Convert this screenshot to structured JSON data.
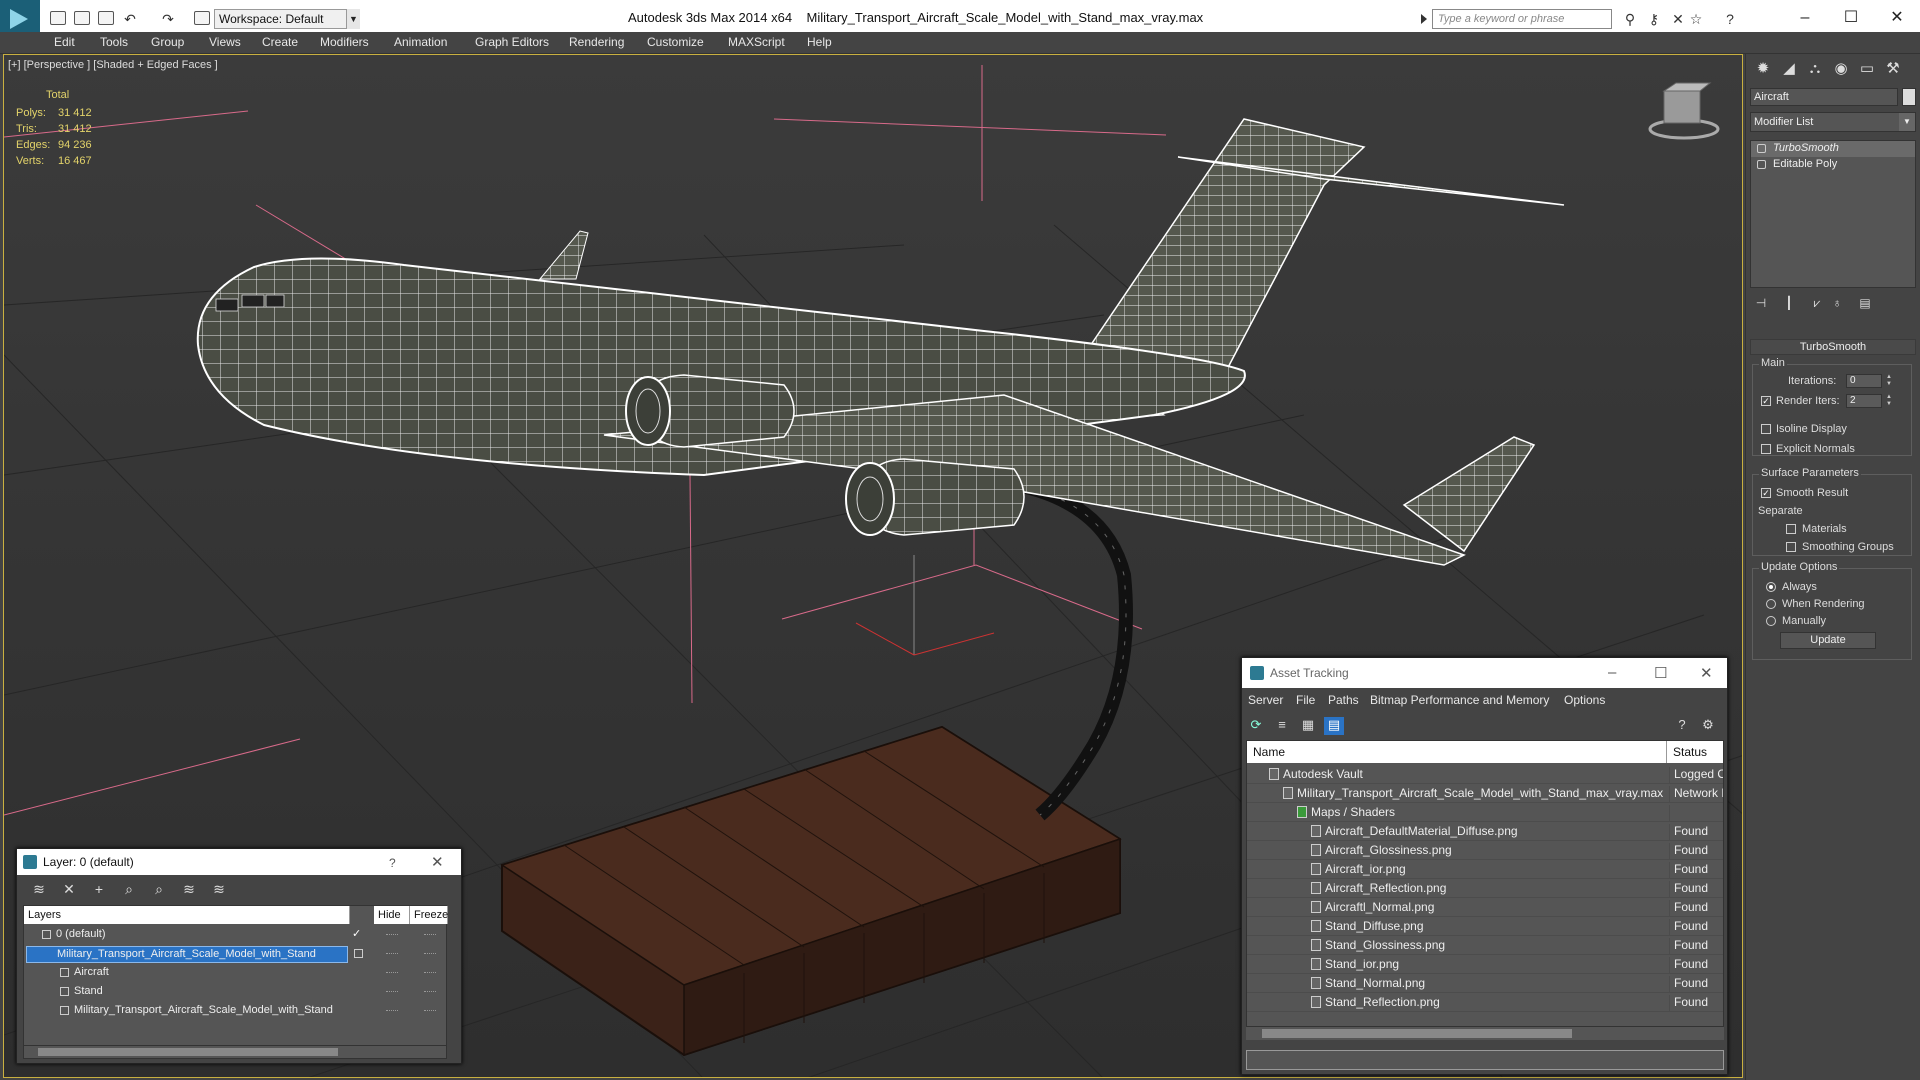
{
  "titlebar": {
    "workspace": "Workspace: Default",
    "app_name": "Autodesk 3ds Max  2014 x64",
    "file_name": "Military_Transport_Aircraft_Scale_Model_with_Stand_max_vray.max",
    "search_placeholder": "Type a keyword or phrase"
  },
  "menu": [
    "Edit",
    "Tools",
    "Group",
    "Views",
    "Create",
    "Modifiers",
    "Animation",
    "Graph Editors",
    "Rendering",
    "Customize",
    "MAXScript",
    "Help"
  ],
  "viewport": {
    "label": "[+] [Perspective ] [Shaded + Edged Faces ]",
    "stats_header": "Total",
    "stats": [
      {
        "label": "Polys:",
        "value": "31 412"
      },
      {
        "label": "Tris:",
        "value": "31 412"
      },
      {
        "label": "Edges:",
        "value": "94 236"
      },
      {
        "label": "Verts:",
        "value": "16 467"
      }
    ]
  },
  "command_panel": {
    "object_name": "Aircraft",
    "modifier_list": "Modifier List",
    "stack": [
      {
        "label": "TurboSmooth",
        "selected": true
      },
      {
        "label": "Editable Poly",
        "selected": false
      }
    ],
    "rollout_title": "TurboSmooth",
    "main_group": "Main",
    "iterations_label": "Iterations:",
    "iterations_value": "0",
    "render_iters_label": "Render Iters:",
    "render_iters_value": "2",
    "isoline_label": "Isoline Display",
    "explicit_normals_label": "Explicit Normals",
    "surface_group": "Surface Parameters",
    "smooth_result_label": "Smooth Result",
    "separate_label": "Separate",
    "materials_label": "Materials",
    "smoothing_groups_label": "Smoothing Groups",
    "update_group": "Update Options",
    "always_label": "Always",
    "when_rendering_label": "When Rendering",
    "manually_label": "Manually",
    "update_button": "Update"
  },
  "layer_dialog": {
    "title": "Layer: 0 (default)",
    "help": "?",
    "col_layers": "Layers",
    "col_hide": "Hide",
    "col_freeze": "Freeze",
    "rows": [
      {
        "name": "0 (default)",
        "indent": 1,
        "selected": false,
        "checked": true
      },
      {
        "name": "Military_Transport_Aircraft_Scale_Model_with_Stand",
        "indent": 1,
        "selected": true,
        "checked": false
      },
      {
        "name": "Aircraft",
        "indent": 2,
        "selected": false,
        "checked": false
      },
      {
        "name": "Stand",
        "indent": 2,
        "selected": false,
        "checked": false
      },
      {
        "name": "Military_Transport_Aircraft_Scale_Model_with_Stand",
        "indent": 2,
        "selected": false,
        "checked": false
      }
    ]
  },
  "asset_dialog": {
    "title": "Asset Tracking",
    "menu": [
      "Server",
      "File",
      "Paths",
      "Bitmap Performance and Memory",
      "Options"
    ],
    "col_name": "Name",
    "col_status": "Status",
    "rows": [
      {
        "name": "Autodesk Vault",
        "indent": 1,
        "status": "Logged O"
      },
      {
        "name": "Military_Transport_Aircraft_Scale_Model_with_Stand_max_vray.max",
        "indent": 2,
        "status": "Network F"
      },
      {
        "name": "Maps / Shaders",
        "indent": 3,
        "status": ""
      },
      {
        "name": "Aircraft_DefaultMaterial_Diffuse.png",
        "indent": 4,
        "status": "Found"
      },
      {
        "name": "Aircraft_Glossiness.png",
        "indent": 4,
        "status": "Found"
      },
      {
        "name": "Aircraft_ior.png",
        "indent": 4,
        "status": "Found"
      },
      {
        "name": "Aircraft_Reflection.png",
        "indent": 4,
        "status": "Found"
      },
      {
        "name": "Aircraftl_Normal.png",
        "indent": 4,
        "status": "Found"
      },
      {
        "name": "Stand_Diffuse.png",
        "indent": 4,
        "status": "Found"
      },
      {
        "name": "Stand_Glossiness.png",
        "indent": 4,
        "status": "Found"
      },
      {
        "name": "Stand_ior.png",
        "indent": 4,
        "status": "Found"
      },
      {
        "name": "Stand_Normal.png",
        "indent": 4,
        "status": "Found"
      },
      {
        "name": "Stand_Reflection.png",
        "indent": 4,
        "status": "Found"
      }
    ]
  }
}
